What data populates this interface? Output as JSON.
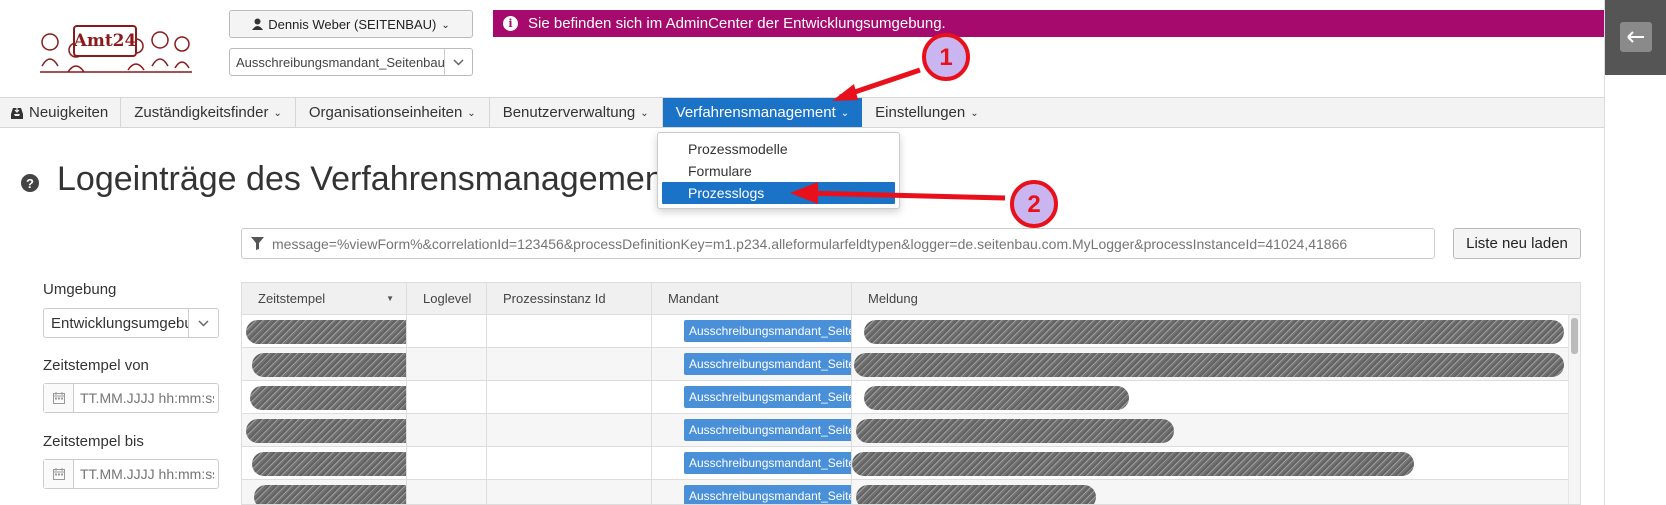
{
  "header": {
    "user_button": "Dennis Weber (SEITENBAU)",
    "mandant_select": "Ausschreibungsmandant_Seitenbau",
    "info_banner": "Sie befinden sich im AdminCenter der Entwicklungsumgebung.",
    "logo_text": "Amt24"
  },
  "nav": {
    "items": [
      {
        "label": "Neuigkeiten"
      },
      {
        "label": "Zuständigkeitsfinder"
      },
      {
        "label": "Organisationseinheiten"
      },
      {
        "label": "Benutzerverwaltung"
      },
      {
        "label": "Verfahrensmanagement",
        "active": true
      },
      {
        "label": "Einstellungen"
      }
    ]
  },
  "dropdown": {
    "items": [
      {
        "label": "Prozessmodelle"
      },
      {
        "label": "Formulare"
      },
      {
        "label": "Prozesslogs",
        "selected": true
      }
    ]
  },
  "page": {
    "title": "Logeinträge des Verfahrensmanagements"
  },
  "filter": {
    "placeholder": "message=%viewForm%&correlationId=123456&processDefinitionKey=m1.p234.alleformularfeldtypen&logger=de.seitenbau.com.MyLogger&processInstanceId=41024,41866",
    "reload_button": "Liste neu laden"
  },
  "sidebar_filters": {
    "environment_label": "Umgebung",
    "environment_value": "Entwicklungsumgebung",
    "from_label": "Zeitstempel von",
    "from_placeholder": "TT.MM.JJJJ hh:mm:ss",
    "to_label": "Zeitstempel bis",
    "to_placeholder": "TT.MM.JJJJ hh:mm:ss"
  },
  "table": {
    "columns": [
      "Zeitstempel",
      "Loglevel",
      "Prozessinstanz Id",
      "Mandant",
      "Meldung"
    ],
    "rows": [
      {
        "mandant": "Ausschreibungsmandant_Seitenbau"
      },
      {
        "mandant": "Ausschreibungsmandant_Seitenbau"
      },
      {
        "mandant": "Ausschreibungsmandant_Seitenbau"
      },
      {
        "mandant": "Ausschreibungsmandant_Seitenbau"
      },
      {
        "mandant": "Ausschreibungsmandant_Seitenbau"
      },
      {
        "mandant": "Ausschreibungsmandant_Seitenbau"
      }
    ]
  },
  "annotations": {
    "step1": "1",
    "step2": "2"
  },
  "colors": {
    "accent": "#1a73c6",
    "banner": "#a50a6c",
    "annotation_red": "#e8101b",
    "annotation_fill": "#c9b6f0"
  }
}
